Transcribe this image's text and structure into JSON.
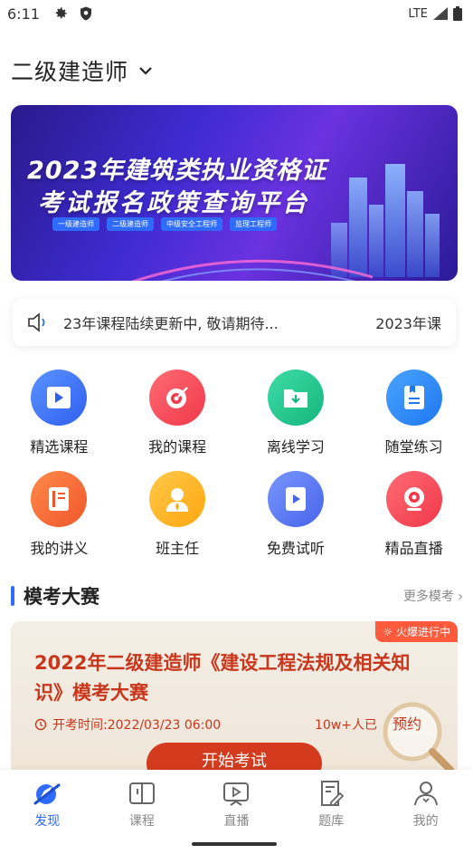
{
  "status_bar": {
    "time": "6:11",
    "network": "LTE"
  },
  "header": {
    "title": "二级建造师"
  },
  "banner": {
    "line1": "2023年建筑类执业资格证",
    "line2": "考试报名政策查询平台",
    "tags": [
      "一级建造师",
      "二级建造师",
      "中级安全工程师",
      "监理工程师"
    ]
  },
  "notice": {
    "text": "23年课程陆续更新中, 敬请期待...",
    "text_next": "2023年课"
  },
  "grid": [
    {
      "label": "精选课程",
      "icon": "play-video-icon",
      "color": "#3d7bff"
    },
    {
      "label": "我的课程",
      "icon": "target-icon",
      "color": "#ff4a5a"
    },
    {
      "label": "离线学习",
      "icon": "download-folder-icon",
      "color": "#22c38e"
    },
    {
      "label": "随堂练习",
      "icon": "notebook-icon",
      "color": "#2f8bff"
    },
    {
      "label": "我的讲义",
      "icon": "handout-icon",
      "color": "#ff6a3c"
    },
    {
      "label": "班主任",
      "icon": "teacher-icon",
      "color": "#ffb21f"
    },
    {
      "label": "免费试听",
      "icon": "free-play-icon",
      "color": "#4f74f0"
    },
    {
      "label": "精品直播",
      "icon": "webcam-icon",
      "color": "#ff4a5a"
    }
  ],
  "section": {
    "title": "模考大赛",
    "more": "更多模考 ›"
  },
  "contest": {
    "hot_badge": "火爆进行中",
    "title": "2022年二级建造师《建设工程法规及相关知识》模考大赛",
    "time": "开考时间:2022/03/23 06:00",
    "count": "10w+人已",
    "book_label": "预约",
    "start_label": "开始考试"
  },
  "bottom_nav": [
    {
      "label": "发现",
      "icon": "discover-icon",
      "active": true
    },
    {
      "label": "课程",
      "icon": "book-icon",
      "active": false
    },
    {
      "label": "直播",
      "icon": "live-icon",
      "active": false
    },
    {
      "label": "题库",
      "icon": "question-bank-icon",
      "active": false
    },
    {
      "label": "我的",
      "icon": "profile-icon",
      "active": false
    }
  ],
  "colors": {
    "accent": "#2f6bff",
    "contest_red": "#c9361c"
  }
}
